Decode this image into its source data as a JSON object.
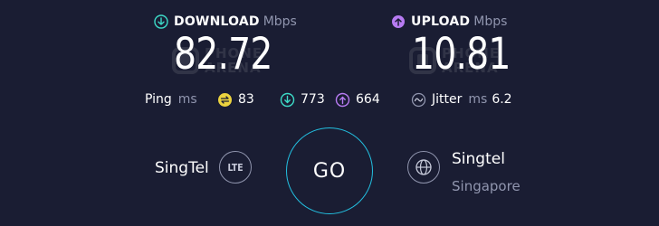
{
  "download": {
    "label": "DOWNLOAD",
    "unit": "Mbps",
    "value": "82.72"
  },
  "upload": {
    "label": "UPLOAD",
    "unit": "Mbps",
    "value": "10.81"
  },
  "watermark": {
    "line1": "PHONE",
    "line2": "ARENA"
  },
  "ping": {
    "label": "Ping",
    "unit": "ms",
    "idle": "83",
    "down": "773",
    "up": "664"
  },
  "jitter": {
    "label": "Jitter",
    "unit": "ms",
    "value": "6.2"
  },
  "provider": {
    "name": "SingTel",
    "badge": "LTE"
  },
  "go_label": "GO",
  "server": {
    "name": "Singtel",
    "location": "Singapore"
  },
  "colors": {
    "background": "#1a1d33",
    "download": "#3ddbc8",
    "upload": "#b77bf2",
    "idle": "#ecd33f",
    "go_ring": "#23bfe0"
  }
}
